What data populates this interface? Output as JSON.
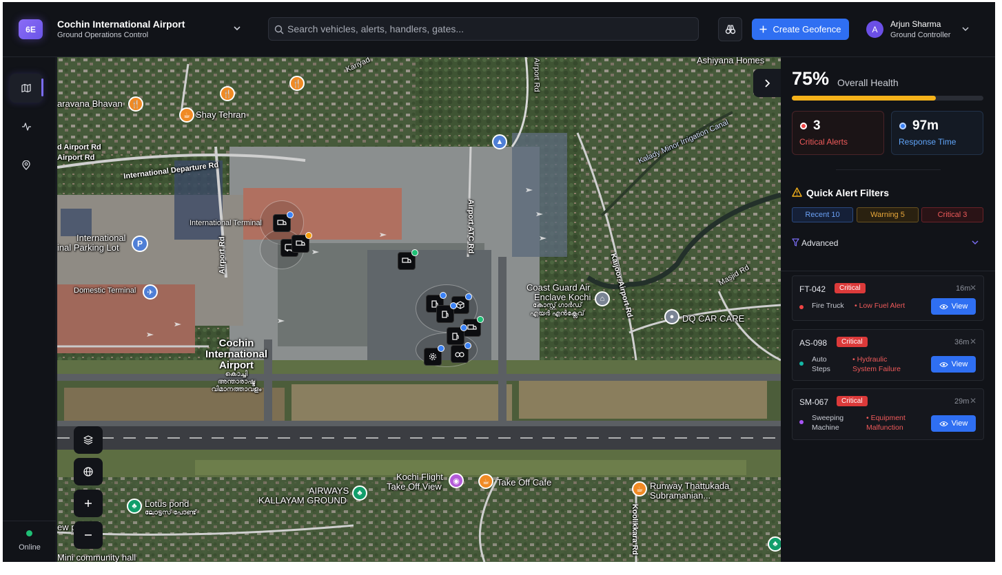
{
  "header": {
    "logo_text": "6E",
    "title": "Cochin International Airport",
    "subtitle": "Ground Operations Control",
    "search_placeholder": "Search vehicles, alerts, handlers, gates...",
    "create_geofence_label": "Create Geofence",
    "user": {
      "initial": "A",
      "name": "Arjun Sharma",
      "role": "Ground Controller"
    }
  },
  "rail": {
    "items": [
      {
        "icon": "map-icon",
        "active": true
      },
      {
        "icon": "activity-icon",
        "active": false
      },
      {
        "icon": "location-pin-icon",
        "active": false
      }
    ],
    "status_label": "Online"
  },
  "map": {
    "labels": {
      "saravana": "aravana Bhavan",
      "shay": "Shay Tehran",
      "karivad": "Kariyad",
      "airport_rd_top": "Airport Rd",
      "ashiyana": "Ashiyana Homes",
      "intl_airport_rd1": "d Airport Rd",
      "intl_airport_rd2": "Airport Rd",
      "intl_departure": "International Departure Rd",
      "kalady": "Kalady Minor Irrigation Canal",
      "intl_terminal": "International Terminal",
      "intl_parking1": "International",
      "intl_parking2": "inal Parking Lot",
      "airport_rd_mid": "Airport Rd",
      "airport_atc": "Airport ATC Rd",
      "kaijoor": "Kaijoor-Airport Rd",
      "masjid": "Masjid Rd",
      "domestic": "Domestic Terminal",
      "coast_guard1": "Coast Guard Air",
      "coast_guard2": "Enclave Kochi",
      "coast_guard_ml1": "കോസ്റ്റ് ഗാർഡ്",
      "coast_guard_ml2": "എയർ എൻക്ലേവ്",
      "dq": "DQ CAR CARE",
      "cochin1": "Cochin",
      "cochin2": "International",
      "cochin3": "Airport",
      "cochin_ml1": "കൊച്ചി",
      "cochin_ml2": "അന്താരാഷ്ട്ര",
      "cochin_ml3": "വിമാനത്താവളം",
      "kochi_flight1": "Kochi Flight",
      "kochi_flight2": "Take Off View",
      "takeoff_cafe": "Take Off Cafe",
      "runway1": "Runway Thattukada",
      "runway2": "Subramanian...",
      "airways1": "AIRWAYS",
      "airways2": "KALLAYAM GROUND",
      "lotus": "Lotus pond",
      "lotus_ml": "ലോട്ടസ് പോണ്ട്",
      "viewpoint": "ew point",
      "koolikkara": "Koolikkara Rd",
      "mini_hall": "Mini community hall"
    },
    "controls": [
      "layers-icon",
      "globe-icon",
      "zoom-in",
      "zoom-out"
    ],
    "parking_glyph": "P"
  },
  "panel": {
    "health": {
      "percent_label": "75%",
      "label": "Overall Health",
      "value": 0.75
    },
    "stats": {
      "critical": {
        "value": "3",
        "label": "Critical Alerts",
        "color": "#ef4444"
      },
      "response": {
        "value": "97m",
        "label": "Response Time",
        "color": "#3b82f6"
      }
    },
    "quick_filters_title": "Quick Alert Filters",
    "chips": {
      "recent": "Recent 10",
      "warning": "Warning 5",
      "critical": "Critical 3"
    },
    "advanced_label": "Advanced",
    "alerts": [
      {
        "id": "FT-042",
        "severity": "Critical",
        "age": "16m",
        "type": "Fire Truck",
        "issue": "• Low Fuel Alert",
        "dot_color": "#ef4444",
        "view_label": "View"
      },
      {
        "id": "AS-098",
        "severity": "Critical",
        "age": "36m",
        "type": "Auto Steps",
        "issue": "• Hydraulic System Failure",
        "dot_color": "#14b8a6",
        "view_label": "View"
      },
      {
        "id": "SM-067",
        "severity": "Critical",
        "age": "29m",
        "type": "Sweeping Machine",
        "issue": "• Equipment Malfunction",
        "dot_color": "#a855f7",
        "view_label": "View"
      }
    ]
  }
}
